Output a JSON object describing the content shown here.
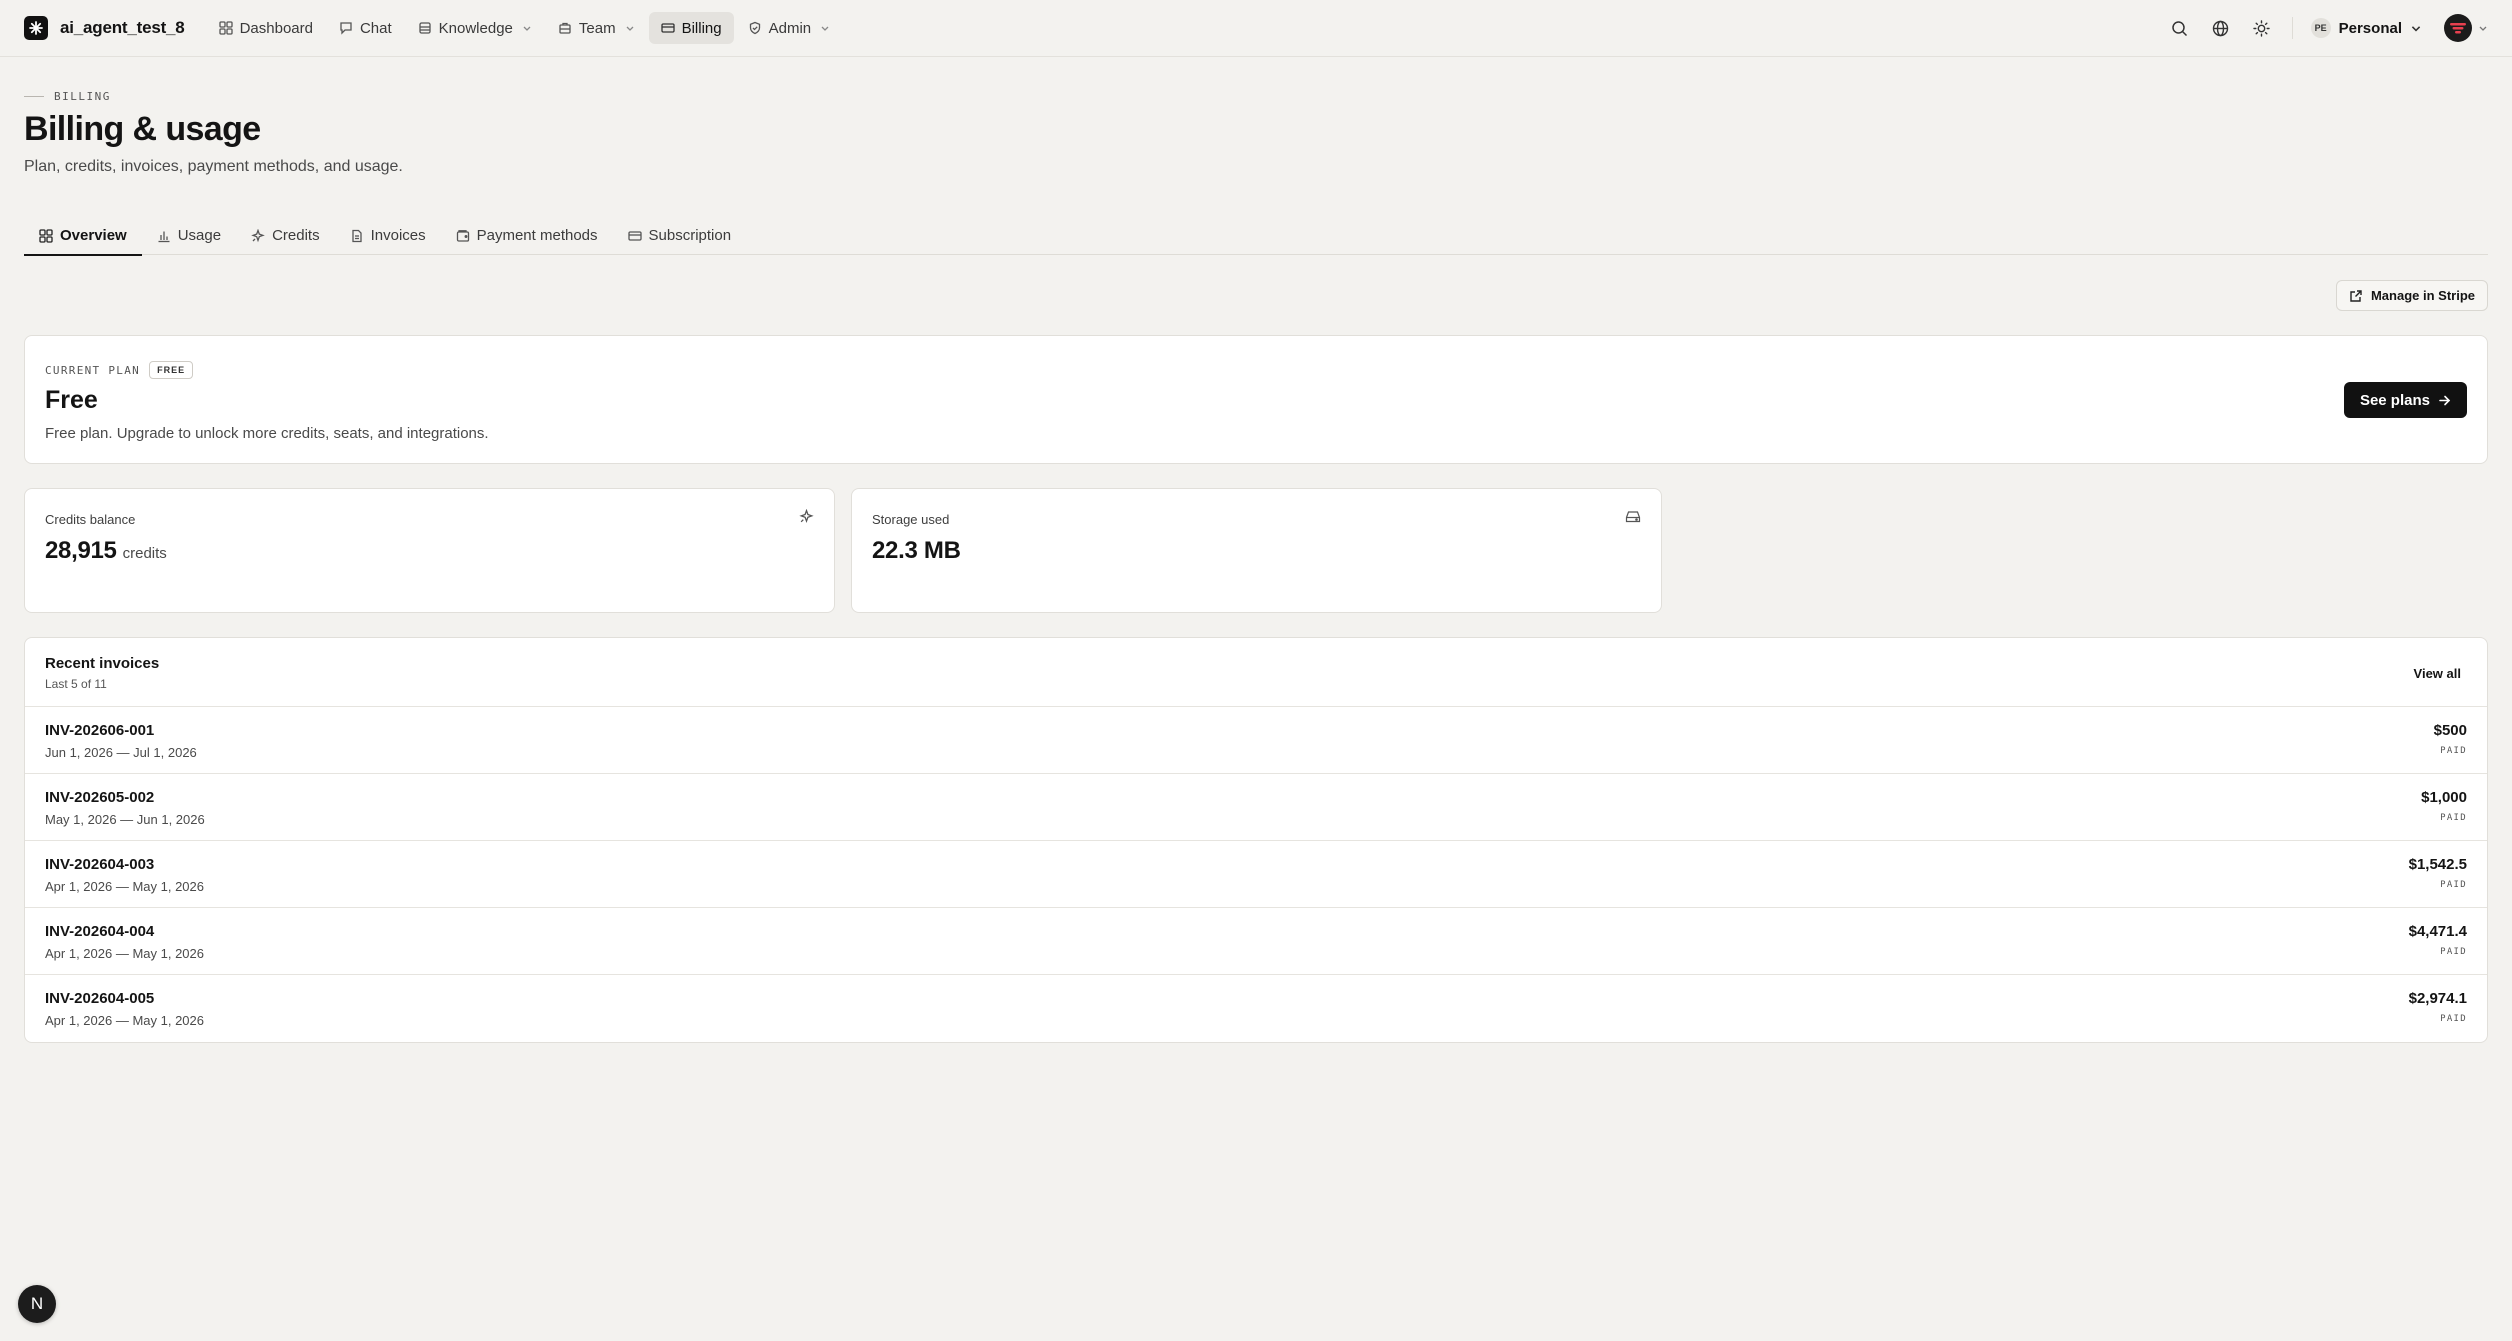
{
  "app": {
    "name": "ai_agent_test_8"
  },
  "nav": {
    "items": [
      {
        "label": "Dashboard",
        "icon": "dashboard-icon",
        "active": false,
        "dropdown": false
      },
      {
        "label": "Chat",
        "icon": "chat-icon",
        "active": false,
        "dropdown": false
      },
      {
        "label": "Knowledge",
        "icon": "database-icon",
        "active": false,
        "dropdown": true
      },
      {
        "label": "Team",
        "icon": "team-icon",
        "active": false,
        "dropdown": true
      },
      {
        "label": "Billing",
        "icon": "card-icon",
        "active": true,
        "dropdown": false
      },
      {
        "label": "Admin",
        "icon": "shield-icon",
        "active": false,
        "dropdown": true
      }
    ],
    "right": {
      "search_icon": "search-icon",
      "language_icon": "globe-icon",
      "theme_icon": "sun-icon"
    },
    "workspace": {
      "badge": "PE",
      "label": "Personal"
    }
  },
  "header": {
    "eyebrow": "BILLING",
    "title": "Billing & usage",
    "subtitle": "Plan, credits, invoices, payment methods, and usage."
  },
  "tabs": [
    {
      "label": "Overview",
      "icon": "grid-icon",
      "active": true
    },
    {
      "label": "Usage",
      "icon": "bar-chart-icon",
      "active": false
    },
    {
      "label": "Credits",
      "icon": "sparkle-icon",
      "active": false
    },
    {
      "label": "Invoices",
      "icon": "document-icon",
      "active": false
    },
    {
      "label": "Payment methods",
      "icon": "wallet-icon",
      "active": false
    },
    {
      "label": "Subscription",
      "icon": "card-icon",
      "active": false
    }
  ],
  "manage_stripe_label": "Manage in Stripe",
  "plan": {
    "label": "CURRENT PLAN",
    "badge": "FREE",
    "name": "Free",
    "description": "Free plan. Upgrade to unlock more credits, seats, and integrations.",
    "cta": "See plans"
  },
  "stats": {
    "credits": {
      "label": "Credits balance",
      "value": "28,915",
      "unit": "credits",
      "icon": "sparkle-icon"
    },
    "storage": {
      "label": "Storage used",
      "value": "22.3 MB",
      "icon": "drive-icon"
    }
  },
  "invoices": {
    "title": "Recent invoices",
    "count": "Last 5 of 11",
    "view_all": "View all",
    "rows": [
      {
        "id": "INV-202606-001",
        "period": "Jun 1, 2026 — Jul 1, 2026",
        "amount": "$500",
        "status": "PAID"
      },
      {
        "id": "INV-202605-002",
        "period": "May 1, 2026 — Jun 1, 2026",
        "amount": "$1,000",
        "status": "PAID"
      },
      {
        "id": "INV-202604-003",
        "period": "Apr 1, 2026 — May 1, 2026",
        "amount": "$1,542.5",
        "status": "PAID"
      },
      {
        "id": "INV-202604-004",
        "period": "Apr 1, 2026 — May 1, 2026",
        "amount": "$4,471.4",
        "status": "PAID"
      },
      {
        "id": "INV-202604-005",
        "period": "Apr 1, 2026 — May 1, 2026",
        "amount": "$2,974.1",
        "status": "PAID"
      }
    ]
  },
  "floating_badge": "N"
}
